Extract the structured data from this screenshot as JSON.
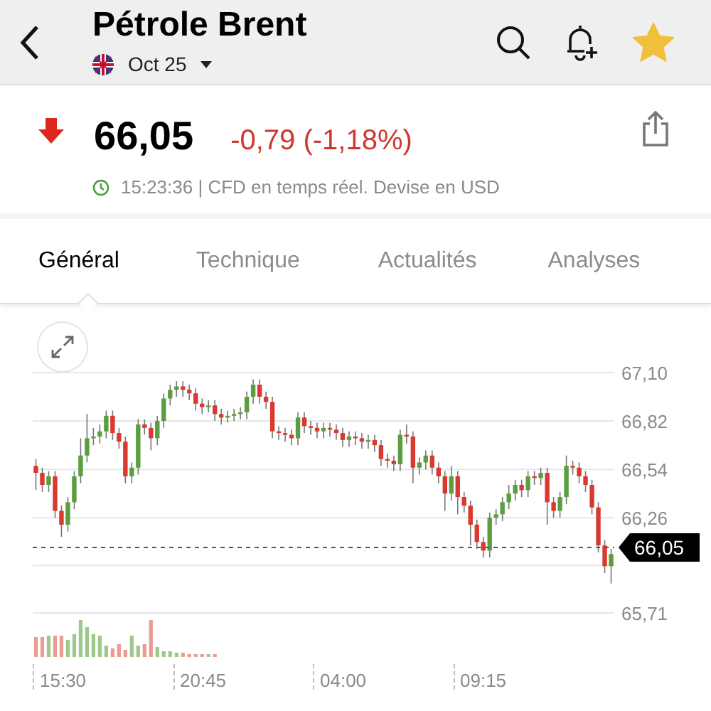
{
  "header": {
    "title": "Pétrole Brent",
    "contract": "Oct 25",
    "favorite": true
  },
  "quote": {
    "falling": true,
    "price": "66,05",
    "change": "-0,79 (-1,18%)",
    "time_note": "15:23:36 | CFD en temps réel. Devise en USD"
  },
  "tabs": [
    {
      "label": "Général",
      "selected": true
    },
    {
      "label": "Technique",
      "selected": false
    },
    {
      "label": "Actualités",
      "selected": false
    },
    {
      "label": "Analyses",
      "selected": false
    }
  ],
  "chart": {
    "current_price": "66,05",
    "x_labels": [
      "15:30",
      "20:45",
      "04:00",
      "09:15"
    ],
    "chart_data": {
      "type": "candlestick",
      "categories": [
        null,
        null,
        null,
        null,
        null,
        null,
        null,
        null,
        null,
        null,
        null,
        null,
        null,
        null,
        null,
        null,
        null,
        null,
        null,
        null,
        null,
        null,
        null,
        null,
        null,
        null,
        null,
        null,
        null,
        null,
        null,
        null,
        null,
        null,
        null,
        null,
        null,
        null,
        null,
        null,
        null,
        null,
        null,
        null,
        null,
        null,
        null,
        null,
        null,
        null,
        null,
        null,
        null,
        null,
        null,
        null,
        null,
        null,
        null,
        null,
        null,
        null,
        null,
        null,
        null,
        null,
        null,
        null,
        null,
        null,
        null,
        null,
        null,
        null,
        null,
        null,
        null,
        null,
        null,
        null,
        null,
        null,
        null,
        null,
        null,
        null,
        null,
        null,
        null,
        null,
        null
      ],
      "ylim": [
        65.71,
        67.1
      ],
      "grid": true,
      "yticks": [
        {
          "value": 67.1,
          "label": "67,10"
        },
        {
          "value": 66.82,
          "label": "66,82"
        },
        {
          "value": 66.54,
          "label": "66,54"
        },
        {
          "value": 66.26,
          "label": "66,26"
        },
        {
          "value": 65.71,
          "label": "65,71"
        }
      ],
      "ohlc": [
        [
          66.56,
          66.6,
          66.42,
          66.52
        ],
        [
          66.52,
          66.55,
          66.41,
          66.45
        ],
        [
          66.45,
          66.53,
          66.41,
          66.5
        ],
        [
          66.5,
          66.53,
          66.26,
          66.3
        ],
        [
          66.3,
          66.33,
          66.15,
          66.22
        ],
        [
          66.22,
          66.38,
          66.18,
          66.35
        ],
        [
          66.35,
          66.53,
          66.31,
          66.5
        ],
        [
          66.5,
          66.72,
          66.46,
          66.62
        ],
        [
          66.62,
          66.86,
          66.58,
          66.72
        ],
        [
          66.72,
          66.78,
          66.68,
          66.73
        ],
        [
          66.73,
          66.8,
          66.69,
          66.76
        ],
        [
          66.76,
          66.88,
          66.72,
          66.85
        ],
        [
          66.85,
          66.88,
          66.71,
          66.75
        ],
        [
          66.75,
          66.78,
          66.66,
          66.7
        ],
        [
          66.7,
          66.73,
          66.46,
          66.5
        ],
        [
          66.5,
          66.58,
          66.46,
          66.55
        ],
        [
          66.55,
          66.83,
          66.51,
          66.8
        ],
        [
          66.8,
          66.83,
          66.74,
          66.78
        ],
        [
          66.78,
          66.81,
          66.65,
          66.72
        ],
        [
          66.72,
          66.85,
          66.68,
          66.82
        ],
        [
          66.82,
          66.98,
          66.78,
          66.95
        ],
        [
          66.95,
          67.03,
          66.91,
          67.0
        ],
        [
          67.0,
          67.05,
          66.96,
          67.02
        ],
        [
          67.02,
          67.05,
          66.96,
          67.0
        ],
        [
          67.0,
          67.03,
          66.94,
          66.98
        ],
        [
          66.98,
          67.01,
          66.88,
          66.92
        ],
        [
          66.92,
          66.95,
          66.86,
          66.9
        ],
        [
          66.9,
          66.94,
          66.87,
          66.91
        ],
        [
          66.91,
          66.94,
          66.82,
          66.86
        ],
        [
          66.86,
          66.89,
          66.8,
          66.84
        ],
        [
          66.84,
          66.88,
          66.81,
          66.85
        ],
        [
          66.85,
          66.89,
          66.82,
          66.86
        ],
        [
          66.86,
          66.9,
          66.83,
          66.87
        ],
        [
          66.87,
          66.99,
          66.83,
          66.96
        ],
        [
          66.96,
          67.06,
          66.92,
          67.03
        ],
        [
          67.03,
          67.06,
          66.92,
          66.96
        ],
        [
          66.96,
          66.99,
          66.89,
          66.93
        ],
        [
          66.93,
          66.96,
          66.72,
          66.76
        ],
        [
          66.76,
          66.79,
          66.71,
          66.75
        ],
        [
          66.75,
          66.78,
          66.7,
          66.74
        ],
        [
          66.74,
          66.77,
          66.68,
          66.72
        ],
        [
          66.72,
          66.87,
          66.68,
          66.84
        ],
        [
          66.84,
          66.87,
          66.75,
          66.79
        ],
        [
          66.79,
          66.82,
          66.74,
          66.78
        ],
        [
          66.78,
          66.81,
          66.72,
          66.76
        ],
        [
          66.76,
          66.81,
          66.72,
          66.78
        ],
        [
          66.78,
          66.81,
          66.73,
          66.77
        ],
        [
          66.77,
          66.8,
          66.71,
          66.75
        ],
        [
          66.75,
          66.78,
          66.67,
          66.71
        ],
        [
          66.71,
          66.76,
          66.67,
          66.73
        ],
        [
          66.73,
          66.76,
          66.68,
          66.72
        ],
        [
          66.72,
          66.75,
          66.66,
          66.7
        ],
        [
          66.7,
          66.74,
          66.66,
          66.71
        ],
        [
          66.71,
          66.74,
          66.64,
          66.68
        ],
        [
          66.68,
          66.71,
          66.56,
          66.6
        ],
        [
          66.6,
          66.63,
          66.55,
          66.59
        ],
        [
          66.59,
          66.62,
          66.53,
          66.57
        ],
        [
          66.57,
          66.77,
          66.53,
          66.74
        ],
        [
          66.74,
          66.8,
          66.69,
          66.73
        ],
        [
          66.73,
          66.76,
          66.46,
          66.55
        ],
        [
          66.55,
          66.61,
          66.51,
          66.58
        ],
        [
          66.58,
          66.65,
          66.54,
          66.62
        ],
        [
          66.62,
          66.65,
          66.51,
          66.55
        ],
        [
          66.55,
          66.58,
          66.46,
          66.5
        ],
        [
          66.5,
          66.53,
          66.3,
          66.4
        ],
        [
          66.4,
          66.56,
          66.36,
          66.5
        ],
        [
          66.5,
          66.53,
          66.28,
          66.38
        ],
        [
          66.38,
          66.41,
          66.29,
          66.33
        ],
        [
          66.33,
          66.36,
          66.1,
          66.22
        ],
        [
          66.22,
          66.25,
          66.08,
          66.12
        ],
        [
          66.12,
          66.15,
          66.03,
          66.07
        ],
        [
          66.07,
          66.29,
          66.03,
          66.26
        ],
        [
          66.26,
          66.31,
          66.22,
          66.28
        ],
        [
          66.28,
          66.38,
          66.24,
          66.35
        ],
        [
          66.35,
          66.45,
          66.31,
          66.4
        ],
        [
          66.4,
          66.48,
          66.36,
          66.45
        ],
        [
          66.45,
          66.48,
          66.38,
          66.42
        ],
        [
          66.42,
          66.53,
          66.38,
          66.5
        ],
        [
          66.5,
          66.53,
          66.45,
          66.49
        ],
        [
          66.49,
          66.55,
          66.45,
          66.52
        ],
        [
          66.52,
          66.55,
          66.22,
          66.35
        ],
        [
          66.35,
          66.38,
          66.26,
          66.3
        ],
        [
          66.3,
          66.41,
          66.26,
          66.38
        ],
        [
          66.38,
          66.62,
          66.34,
          66.56
        ],
        [
          66.56,
          66.59,
          66.51,
          66.55
        ],
        [
          66.55,
          66.58,
          66.46,
          66.5
        ],
        [
          66.5,
          66.53,
          66.41,
          66.45
        ],
        [
          66.45,
          66.48,
          66.28,
          66.32
        ],
        [
          66.32,
          66.35,
          66.06,
          66.1
        ],
        [
          66.1,
          66.13,
          65.94,
          65.98
        ],
        [
          65.98,
          66.08,
          65.88,
          66.05
        ]
      ]
    }
  }
}
